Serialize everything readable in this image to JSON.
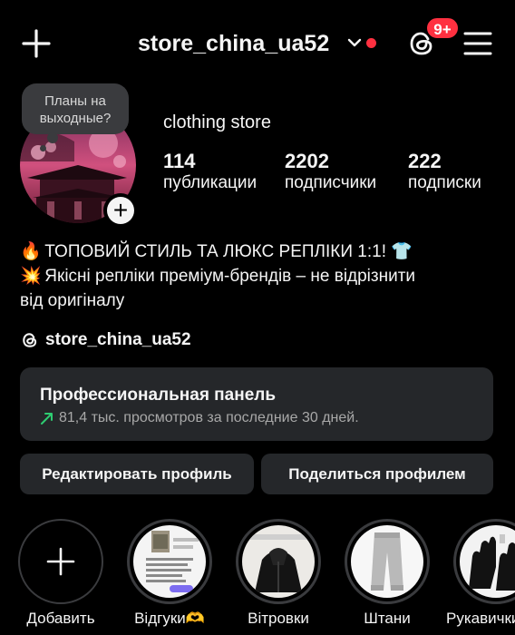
{
  "header": {
    "username": "store_china_ua52",
    "badge_count": "9+",
    "colors": {
      "notification_red": "#ff3040",
      "background": "#000000",
      "panel": "#25272a"
    }
  },
  "profile": {
    "note": "Планы на выходные?",
    "full_name": "clothing store",
    "stats": [
      {
        "value": "114",
        "label": "публикации"
      },
      {
        "value": "2202",
        "label": "подписчики"
      },
      {
        "value": "222",
        "label": "подписки"
      }
    ],
    "bio": {
      "line1_emoji": "🔥",
      "line1_text": "ТОПОВИЙ СТИЛЬ ТА ЛЮКС РЕПЛІКИ 1:1!",
      "line1_trailing_emoji": "👕",
      "line2_emoji": "💥",
      "line2_text": "Якісні репліки преміум-брендів – не відрізнити",
      "line3_text": "від оригіналу"
    },
    "threads_handle": "store_china_ua52"
  },
  "pro_panel": {
    "title": "Профессиональная панель",
    "subtitle": "81,4 тыс. просмотров за последние 30 дней."
  },
  "buttons": {
    "edit_profile": "Редактировать профиль",
    "share_profile": "Поделиться профилем"
  },
  "highlights": [
    {
      "label": "Добавить",
      "icon": "plus-icon"
    },
    {
      "label": "Відгуки🫶",
      "icon": "chat-screenshot"
    },
    {
      "label": "Вітровки",
      "icon": "jacket-photo"
    },
    {
      "label": "Штани",
      "icon": "pants-photo"
    },
    {
      "label": "Рукавички",
      "icon": "gloves-photo"
    }
  ]
}
